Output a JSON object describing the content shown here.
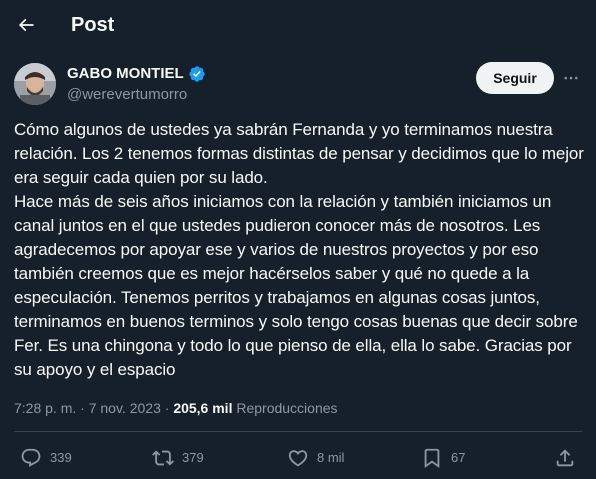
{
  "header": {
    "title": "Post",
    "back_icon": "arrow-left-icon"
  },
  "author": {
    "display_name": "GABO MONTIEL",
    "handle": "@werevertumorro",
    "verified_icon": "verified-badge-icon",
    "verified_color": "#1d9bf0"
  },
  "follow_label": "Seguir",
  "more_icon": "more-horizontal-icon",
  "tweet": {
    "text": "Cómo algunos de ustedes ya sabrán Fernanda y yo terminamos nuestra relación. Los 2 tenemos formas distintas de pensar y decidimos que lo mejor era seguir cada quien por su lado.\nHace más de seis años iniciamos con la relación y también iniciamos un canal juntos en el que ustedes pudieron conocer más de nosotros. Les agradecemos por apoyar ese y varios de nuestros proyectos y por eso también creemos que es mejor hacérselos saber y qué no quede a la especulación. Tenemos perritos y trabajamos en algunas cosas juntos, terminamos en buenos terminos y solo tengo cosas buenas que decir sobre Fer. Es una chingona y todo lo que pienso de ella, ella lo sabe. Gracias por su apoyo y el espacio"
  },
  "meta": {
    "time": "7:28 p. m.",
    "sep1": " · ",
    "date": "7 nov. 2023",
    "sep2": " · ",
    "views": "205,6 mil",
    "views_label": " Reproducciones"
  },
  "actions": {
    "replies": {
      "icon": "reply-icon",
      "count": "339"
    },
    "reposts": {
      "icon": "repost-icon",
      "count": "379"
    },
    "likes": {
      "icon": "heart-icon",
      "count": "8 mil"
    },
    "bookmarks": {
      "icon": "bookmark-icon",
      "count": "67"
    },
    "share": {
      "icon": "share-icon"
    }
  },
  "colors": {
    "background": "#15202b",
    "text_primary": "#f7f9f9",
    "text_secondary": "#8b98a5",
    "divider": "#38444d",
    "follow_bg": "#eff3f4"
  }
}
